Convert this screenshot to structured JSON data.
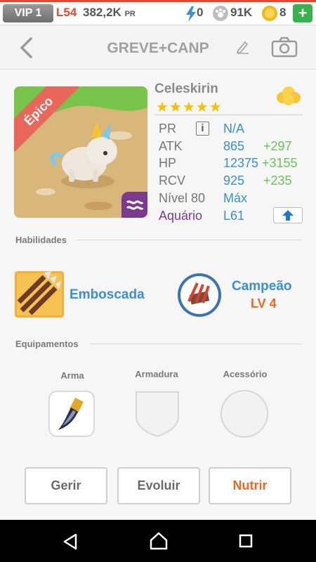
{
  "status_bar": {
    "vip": "VIP 1",
    "level": "L54",
    "power_value": "382,2K",
    "power_unit": "PR",
    "energy": "0",
    "paws": "91K",
    "coins": "8",
    "add": "+"
  },
  "header": {
    "title": "GREVE+CANP"
  },
  "pet": {
    "name": "Celeskirin",
    "rarity": "Épico",
    "stars": "★★★★★",
    "stats": [
      {
        "label": "PR",
        "value": "N/A",
        "bonus": ""
      },
      {
        "label": "ATK",
        "value": "865",
        "bonus": "+297"
      },
      {
        "label": "HP",
        "value": "12375",
        "bonus": "+3155"
      },
      {
        "label": "RCV",
        "value": "925",
        "bonus": "+235"
      },
      {
        "label": "Nível 80",
        "value": "Máx",
        "bonus": ""
      },
      {
        "label": "Aquário",
        "value": "L61",
        "bonus": ""
      }
    ]
  },
  "abilities": {
    "heading": "Habilidades",
    "skill": "Emboscada",
    "leader": "Campeão",
    "leader_level": "LV 4"
  },
  "equipment": {
    "heading": "Equipamentos",
    "slots": [
      "Arma",
      "Armadura",
      "Acessório"
    ]
  },
  "buttons": {
    "manage": "Gerir",
    "evolve": "Evoluir",
    "feed": "Nutrir"
  },
  "colors": {
    "accent_red": "#e8452b",
    "stat_blue": "#3a8ed4",
    "bonus_green": "#6bc25a",
    "feed_orange": "#f26522"
  }
}
